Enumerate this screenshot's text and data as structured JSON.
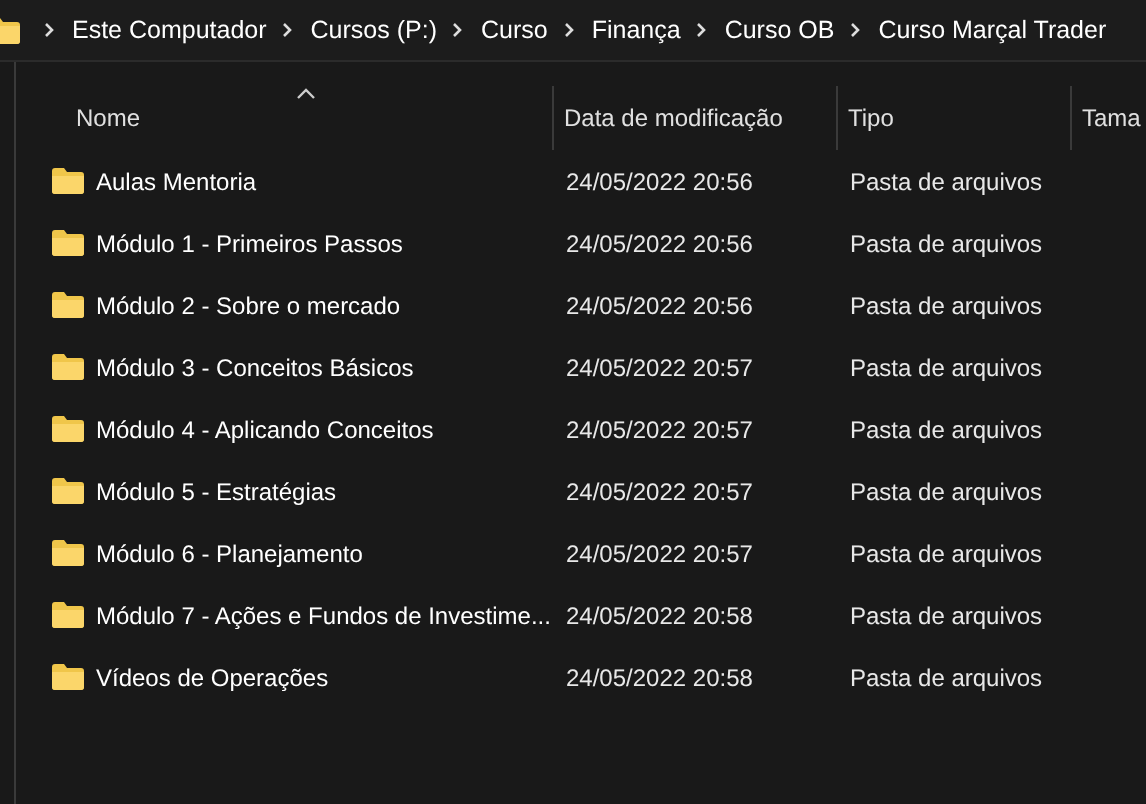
{
  "breadcrumb": [
    "Este Computador",
    "Cursos (P:)",
    "Curso",
    "Finança",
    "Curso OB",
    "Curso Marçal Trader"
  ],
  "columns": [
    {
      "label": "Nome",
      "sorted": true
    },
    {
      "label": "Data de modificação",
      "sorted": false
    },
    {
      "label": "Tipo",
      "sorted": false
    },
    {
      "label": "Tama",
      "sorted": false
    }
  ],
  "rows": [
    {
      "name": "Aulas Mentoria",
      "date": "24/05/2022 20:56",
      "type": "Pasta de arquivos"
    },
    {
      "name": "Módulo 1 - Primeiros Passos",
      "date": "24/05/2022 20:56",
      "type": "Pasta de arquivos"
    },
    {
      "name": "Módulo 2 - Sobre o mercado",
      "date": "24/05/2022 20:56",
      "type": "Pasta de arquivos"
    },
    {
      "name": "Módulo 3 - Conceitos Básicos",
      "date": "24/05/2022 20:57",
      "type": "Pasta de arquivos"
    },
    {
      "name": "Módulo 4 - Aplicando Conceitos",
      "date": "24/05/2022 20:57",
      "type": "Pasta de arquivos"
    },
    {
      "name": "Módulo 5 - Estratégias",
      "date": "24/05/2022 20:57",
      "type": "Pasta de arquivos"
    },
    {
      "name": "Módulo 6 - Planejamento",
      "date": "24/05/2022 20:57",
      "type": "Pasta de arquivos"
    },
    {
      "name": "Módulo 7 - Ações e Fundos de Investime...",
      "date": "24/05/2022 20:58",
      "type": "Pasta de arquivos"
    },
    {
      "name": "Vídeos de Operações",
      "date": "24/05/2022 20:58",
      "type": "Pasta de arquivos"
    }
  ]
}
